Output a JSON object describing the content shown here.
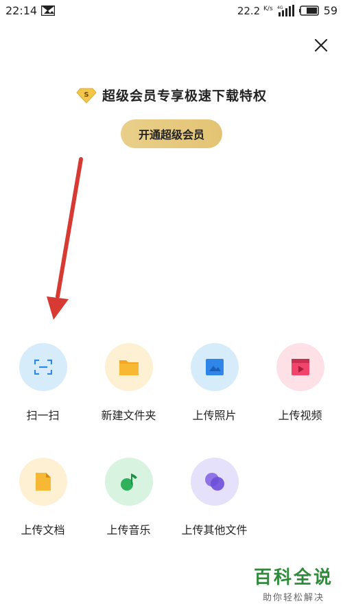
{
  "status_bar": {
    "time": "22:14",
    "speed": "22.2",
    "speed_unit": "K/s",
    "network": "4G",
    "battery": "59"
  },
  "promo": {
    "badge_letter": "S",
    "text": "超级会员专享极速下载特权",
    "button_label": "开通超级会员"
  },
  "tools": [
    {
      "label": "扫一扫",
      "icon": "scan-icon",
      "color": "#d6ecfb"
    },
    {
      "label": "新建文件夹",
      "icon": "folder-icon",
      "color": "#fdf0d3"
    },
    {
      "label": "上传照片",
      "icon": "photo-icon",
      "color": "#d6ecfb"
    },
    {
      "label": "上传视频",
      "icon": "video-icon",
      "color": "#fde1e6"
    },
    {
      "label": "上传文档",
      "icon": "document-icon",
      "color": "#fdf0d3"
    },
    {
      "label": "上传音乐",
      "icon": "music-icon",
      "color": "#d8f3e0"
    },
    {
      "label": "上传其他文件",
      "icon": "other-files-icon",
      "color": "#e6e1fb"
    }
  ],
  "watermark": {
    "main": "百科全说",
    "sub": "助你轻松解决"
  },
  "colors": {
    "annotation_arrow": "#d63a32",
    "vip_gold": "#e6c97e"
  }
}
